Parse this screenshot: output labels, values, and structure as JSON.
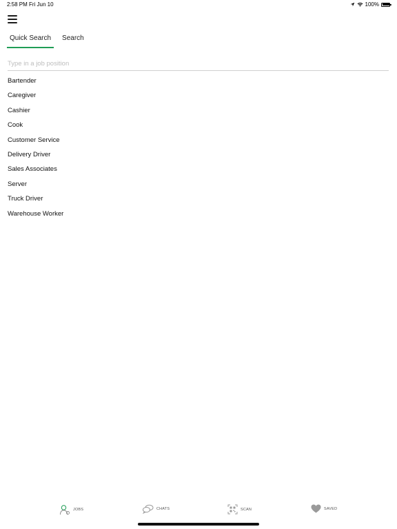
{
  "status_bar": {
    "time": "2:58 PM",
    "date": "Fri Jun 10",
    "battery": "100%"
  },
  "tabs": [
    {
      "label": "Quick Search",
      "active": true
    },
    {
      "label": "Search",
      "active": false
    }
  ],
  "search": {
    "placeholder": "Type in a job position",
    "value": ""
  },
  "jobs": [
    "Bartender",
    "Caregiver",
    "Cashier",
    "Cook",
    "Customer Service",
    "Delivery Driver",
    "Sales Associates",
    "Server",
    "Truck Driver",
    "Warehouse Worker"
  ],
  "bottom_nav": [
    {
      "label": "JOBS",
      "icon": "jobs-icon"
    },
    {
      "label": "CHATS",
      "icon": "chats-icon"
    },
    {
      "label": "SCAN",
      "icon": "scan-icon"
    },
    {
      "label": "SAVED",
      "icon": "heart-icon"
    }
  ],
  "colors": {
    "accent": "#1f9d55",
    "icon_gray": "#9a9a9a"
  }
}
